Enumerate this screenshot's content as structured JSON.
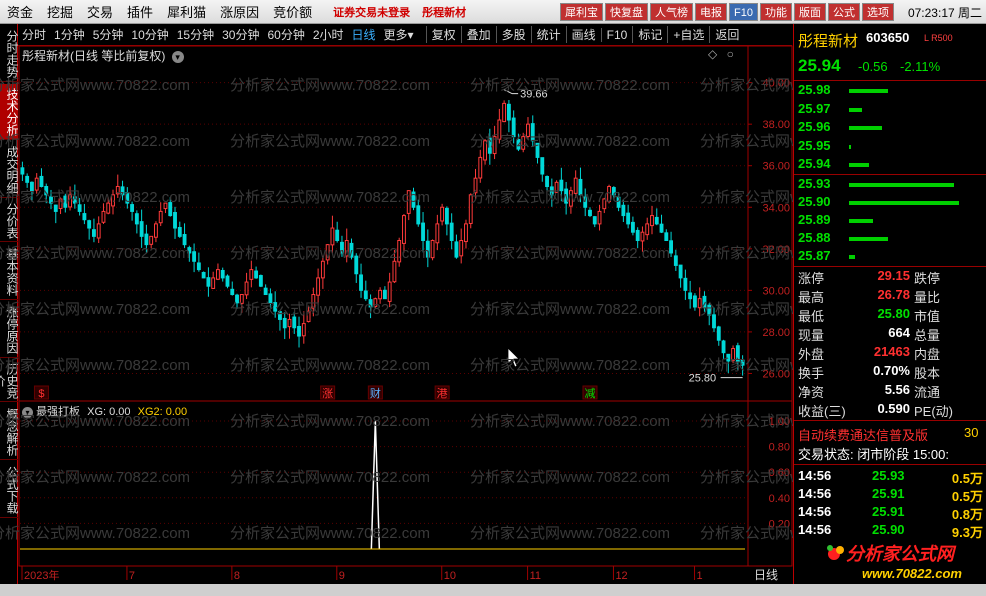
{
  "menu": {
    "items": [
      "资金",
      "挖掘",
      "交易",
      "插件",
      "犀利猫",
      "涨原因",
      "竞价额"
    ],
    "promo": [
      "证券交易未登录",
      "彤程新材"
    ],
    "quick_buttons": [
      {
        "label": "犀利宝",
        "color": "#c03030"
      },
      {
        "label": "快复盘",
        "color": "#c03030"
      },
      {
        "label": "人气榜",
        "color": "#c03030"
      },
      {
        "label": "电报",
        "color": "#c03030"
      },
      {
        "label": "F10",
        "color": "#3a6ab0"
      },
      {
        "label": "功能",
        "color": "#c03030"
      },
      {
        "label": "版面",
        "color": "#c03030"
      },
      {
        "label": "公式",
        "color": "#c03030"
      },
      {
        "label": "选项",
        "color": "#c03030"
      }
    ],
    "clock": "07:23:17 周二"
  },
  "left_tabs": [
    {
      "label": "分时走势",
      "active": false
    },
    {
      "label": "技术分析",
      "active": true
    },
    {
      "label": "成交明细",
      "active": false
    },
    {
      "label": "分价表",
      "active": false
    },
    {
      "label": "基本资料",
      "active": false
    },
    {
      "label": "涨停原因",
      "active": false
    },
    {
      "label": "历史竞价",
      "active": false
    },
    {
      "label": "概念解析",
      "active": false
    },
    {
      "label": "公式下载",
      "active": false
    }
  ],
  "toolbar": {
    "periods": [
      "分时",
      "1分钟",
      "5分钟",
      "10分钟",
      "15分钟",
      "30分钟",
      "60分钟",
      "2小时",
      "日线",
      "更多"
    ],
    "active_period": "日线",
    "tools": [
      "复权",
      "叠加",
      "多股",
      "统计",
      "画线",
      "F10",
      "标记",
      "+自选",
      "返回"
    ]
  },
  "chart": {
    "title": "彤程新材(日线 等比前复权)",
    "high_label": "39.66",
    "low_label": "25.80",
    "price_axis": [
      "40.00",
      "38.00",
      "36.00",
      "34.00",
      "32.00",
      "30.00",
      "28.00",
      "26.00"
    ],
    "price_range": [
      25.3,
      40.8
    ],
    "markers": [
      {
        "label": "$",
        "color": "#ff3030"
      },
      {
        "label": "涨",
        "color": "#ff3030"
      },
      {
        "label": "财",
        "color": "#5ab0ff"
      },
      {
        "label": "港",
        "color": "#ff3030"
      },
      {
        "label": "减",
        "color": "#00e000"
      }
    ],
    "month_axis": [
      "2023年",
      "7",
      "8",
      "9",
      "10",
      "11",
      "12",
      "1"
    ],
    "period_label": "日线",
    "closes": [
      35.6,
      35.2,
      34.8,
      35.4,
      35.0,
      34.6,
      34.2,
      33.8,
      34.4,
      34.0,
      34.6,
      34.2,
      33.8,
      33.4,
      33.0,
      32.6,
      33.2,
      33.8,
      34.2,
      34.6,
      35.0,
      34.6,
      34.2,
      33.8,
      33.2,
      32.6,
      32.2,
      32.6,
      33.2,
      33.8,
      34.2,
      33.6,
      33.0,
      32.6,
      32.2,
      31.8,
      31.4,
      31.0,
      30.6,
      30.2,
      30.6,
      31.0,
      30.6,
      30.2,
      29.8,
      29.4,
      29.8,
      30.4,
      31.0,
      30.6,
      30.2,
      29.8,
      29.4,
      29.0,
      28.6,
      28.2,
      28.6,
      28.2,
      27.8,
      28.4,
      29.0,
      29.8,
      30.6,
      31.4,
      32.2,
      33.0,
      32.4,
      31.8,
      32.4,
      31.6,
      30.8,
      30.0,
      29.6,
      29.2,
      29.6,
      30.0,
      29.6,
      30.4,
      31.4,
      32.4,
      33.6,
      34.8,
      34.0,
      33.2,
      32.4,
      31.6,
      32.4,
      33.2,
      34.0,
      33.2,
      32.4,
      31.6,
      32.4,
      33.2,
      34.6,
      35.4,
      36.4,
      37.2,
      36.6,
      37.4,
      38.2,
      39.0,
      38.2,
      37.4,
      36.8,
      37.4,
      38.0,
      37.2,
      36.4,
      35.6,
      35.0,
      34.6,
      35.2,
      34.8,
      34.2,
      34.8,
      35.4,
      34.6,
      34.0,
      33.6,
      33.2,
      33.8,
      34.4,
      35.0,
      34.6,
      34.0,
      33.6,
      33.2,
      32.8,
      32.4,
      32.8,
      33.2,
      33.6,
      33.2,
      32.8,
      32.4,
      31.8,
      31.2,
      30.6,
      30.0,
      29.6,
      29.2,
      29.6,
      29.2,
      28.8,
      28.2,
      27.6,
      27.0,
      26.6,
      27.2,
      26.6,
      26.4
    ]
  },
  "indicator": {
    "name": "最强打板",
    "xg_label": "XG: 0.00",
    "xg2_label": "XG2: 0.00",
    "axis": [
      "1.00",
      "0.80",
      "0.60",
      "0.40",
      "0.20"
    ],
    "spike_index": 74,
    "spike_value": 1.0
  },
  "watermark": "分析家公式网www.70822.com",
  "quote": {
    "name": "彤程新材",
    "code": "603650",
    "tag": "L R500",
    "price": "25.94",
    "change": "-0.56",
    "change_pct": "-2.11%",
    "asks": [
      {
        "price": "25.98",
        "volume": 35
      },
      {
        "price": "25.97",
        "volume": 12
      },
      {
        "price": "25.96",
        "volume": 30
      },
      {
        "price": "25.95",
        "volume": 2
      },
      {
        "price": "25.94",
        "volume": 18
      }
    ],
    "bids": [
      {
        "price": "25.93",
        "volume": 95
      },
      {
        "price": "25.90",
        "volume": 100
      },
      {
        "price": "25.89",
        "volume": 22
      },
      {
        "price": "25.88",
        "volume": 35
      },
      {
        "price": "25.87",
        "volume": 5
      }
    ],
    "stats": [
      {
        "label": "涨停",
        "value": "29.15",
        "color": "red",
        "label2": "跌停"
      },
      {
        "label": "最高",
        "value": "26.78",
        "color": "red",
        "label2": "量比"
      },
      {
        "label": "最低",
        "value": "25.80",
        "color": "green",
        "label2": "市值"
      },
      {
        "label": "现量",
        "value": "664",
        "color": "white",
        "label2": "总量"
      },
      {
        "label": "外盘",
        "value": "21463",
        "color": "red",
        "label2": "内盘"
      },
      {
        "label": "换手",
        "value": "0.70%",
        "color": "white",
        "label2": "股本"
      },
      {
        "label": "净资",
        "value": "5.56",
        "color": "white",
        "label2": "流通"
      },
      {
        "label": "收益(三)",
        "value": "0.590",
        "color": "white",
        "label2": "PE(动)"
      }
    ],
    "banner": "自动续费通达信普及版",
    "banner_tail": "30",
    "trade_status": "交易状态: 闭市阶段 15:00:",
    "ticks": [
      {
        "time": "14:56",
        "price": "25.93",
        "volume": "0.5万"
      },
      {
        "time": "14:56",
        "price": "25.91",
        "volume": "0.5万"
      },
      {
        "time": "14:56",
        "price": "25.91",
        "volume": "0.8万"
      },
      {
        "time": "14:56",
        "price": "25.90",
        "volume": "9.3万"
      }
    ]
  },
  "logo": {
    "title": "分析家公式网",
    "url": "www.70822.com"
  }
}
